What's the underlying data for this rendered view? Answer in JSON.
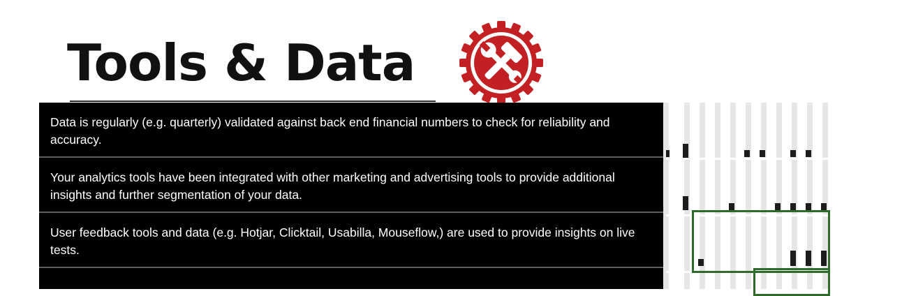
{
  "slide": {
    "title": "Tools & Data",
    "icon": "tools-gear-icon",
    "icon_color": "#c32024"
  },
  "rows": [
    {
      "text": "Data is regularly (e.g. quarterly) validated against back end financial numbers to check for reliability and accuracy."
    },
    {
      "text": "Your analytics tools have been integrated with other marketing and advertising tools to provide additional insights and further segmentation of your data."
    },
    {
      "text": "User feedback tools and data (e.g. Hotjar, Clicktail, Usabilla, Mouseflow,) are used to provide insights on live tests."
    }
  ],
  "colors": {
    "row_background": "#000000",
    "row_text": "#ffffff",
    "highlight_box": "#2e6b2a"
  }
}
